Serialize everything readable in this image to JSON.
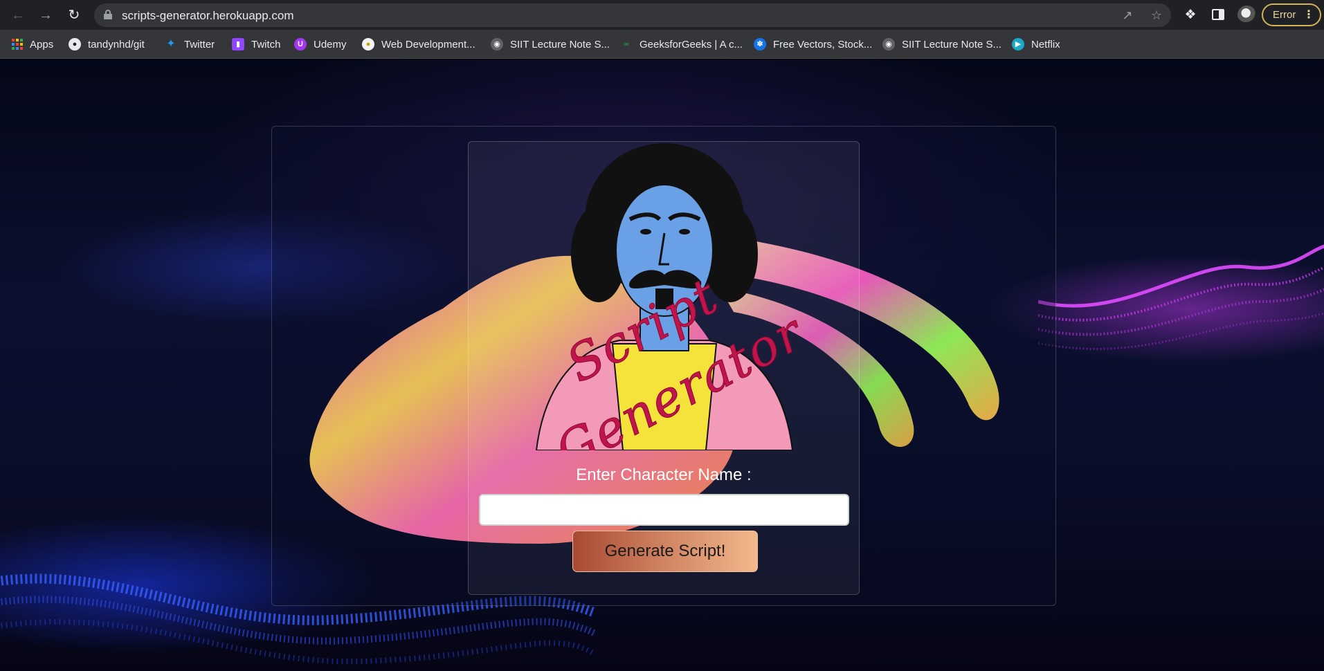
{
  "browser": {
    "url": "scripts-generator.herokuapp.com",
    "profile_status": "Error"
  },
  "bookmarks": [
    {
      "label": "Apps",
      "icon": "apps-grid-icon"
    },
    {
      "label": "tandynhd/git",
      "icon": "github-icon"
    },
    {
      "label": "Twitter",
      "icon": "twitter-icon"
    },
    {
      "label": "Twitch",
      "icon": "twitch-icon"
    },
    {
      "label": "Udemy",
      "icon": "udemy-icon"
    },
    {
      "label": "Web Development...",
      "icon": "web-dev-icon"
    },
    {
      "label": "SIIT Lecture Note S...",
      "icon": "globe-icon"
    },
    {
      "label": "GeeksforGeeks | A c...",
      "icon": "geeksforgeeks-icon"
    },
    {
      "label": "Free Vectors, Stock...",
      "icon": "freepik-icon"
    },
    {
      "label": "SIIT Lecture Note S...",
      "icon": "globe-icon"
    },
    {
      "label": "Netflix",
      "icon": "netflix-icon"
    }
  ],
  "app": {
    "logo_text": "Script Generator",
    "form_label": "Enter Character Name :",
    "name_value": "",
    "button_label": "Generate Script!"
  },
  "colors": {
    "logo_text": "#c0144b",
    "button_start": "#a84a33",
    "button_end": "#f3b88c"
  }
}
